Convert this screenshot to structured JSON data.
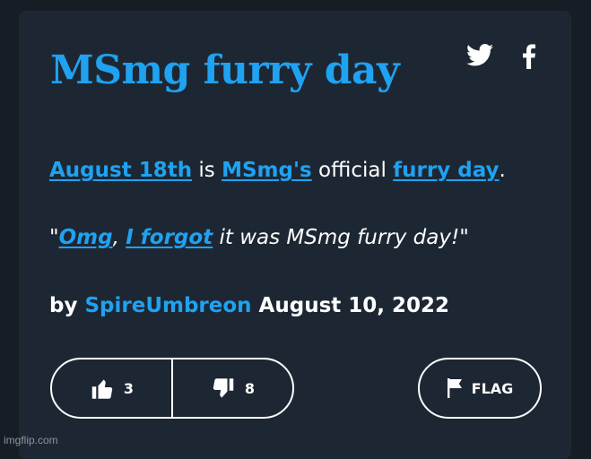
{
  "definition": {
    "word": "MSmg furry day",
    "body": {
      "link_date": "August 18th",
      "text_is": " is ",
      "link_msmgs": "MSmg's",
      "text_official": " official ",
      "link_furry_day": "furry day",
      "text_period": "."
    },
    "example": {
      "quote_open": "\"",
      "link_omg": "Omg",
      "comma": ", ",
      "link_i_forgot": "I forgot",
      "rest": " it was MSmg furry day!\""
    },
    "byline": {
      "by": "by ",
      "author": "SpireUmbreon",
      "date": " August 10, 2022"
    },
    "thumbs_up_count": "3",
    "thumbs_down_count": "8",
    "flag_label": "FLAG"
  },
  "share": {
    "twitter_icon": "twitter-icon",
    "facebook_icon": "facebook-icon"
  },
  "watermark": "imgflip.com",
  "colors": {
    "page_background": "#161d25",
    "card_background": "#1d2733",
    "accent": "#1fa2f1",
    "text": "#ffffff"
  }
}
